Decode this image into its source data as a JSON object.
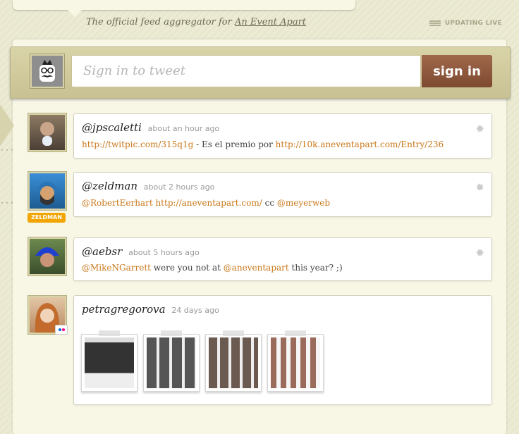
{
  "header": {
    "tagline_prefix": "The official feed aggregator for",
    "tagline_link": "An Event Apart",
    "updating_label": "UPDATING LIVE"
  },
  "tweetbar": {
    "placeholder": "Sign in to tweet",
    "sign_in_label": "sign in"
  },
  "feed": [
    {
      "user": "@jpscaletti",
      "time": "about an hour ago",
      "link1": "http://twitpic.com/315q1g",
      "mid": " - Es el premio por ",
      "link2": "http://10k.aneventapart.com/Entry/236"
    },
    {
      "user": "@zeldman",
      "time": "about 2 hours ago",
      "link1": "@RobertEerhart http://aneventapart.com/",
      "mid": " cc ",
      "link2": "@meyerweb",
      "badge": "ZELDMAN"
    },
    {
      "user": "@aebsr",
      "time": "about 5 hours ago",
      "link1": "@MikeNGarrett",
      "mid": " were you not at ",
      "link2": "@aneventapart",
      "tail": " this year? ;)"
    },
    {
      "user": "petragregorova",
      "time": "24 days ago"
    }
  ],
  "colors": {
    "link": "#c9781a",
    "button": "#8a5436",
    "badge": "#f2a500"
  }
}
